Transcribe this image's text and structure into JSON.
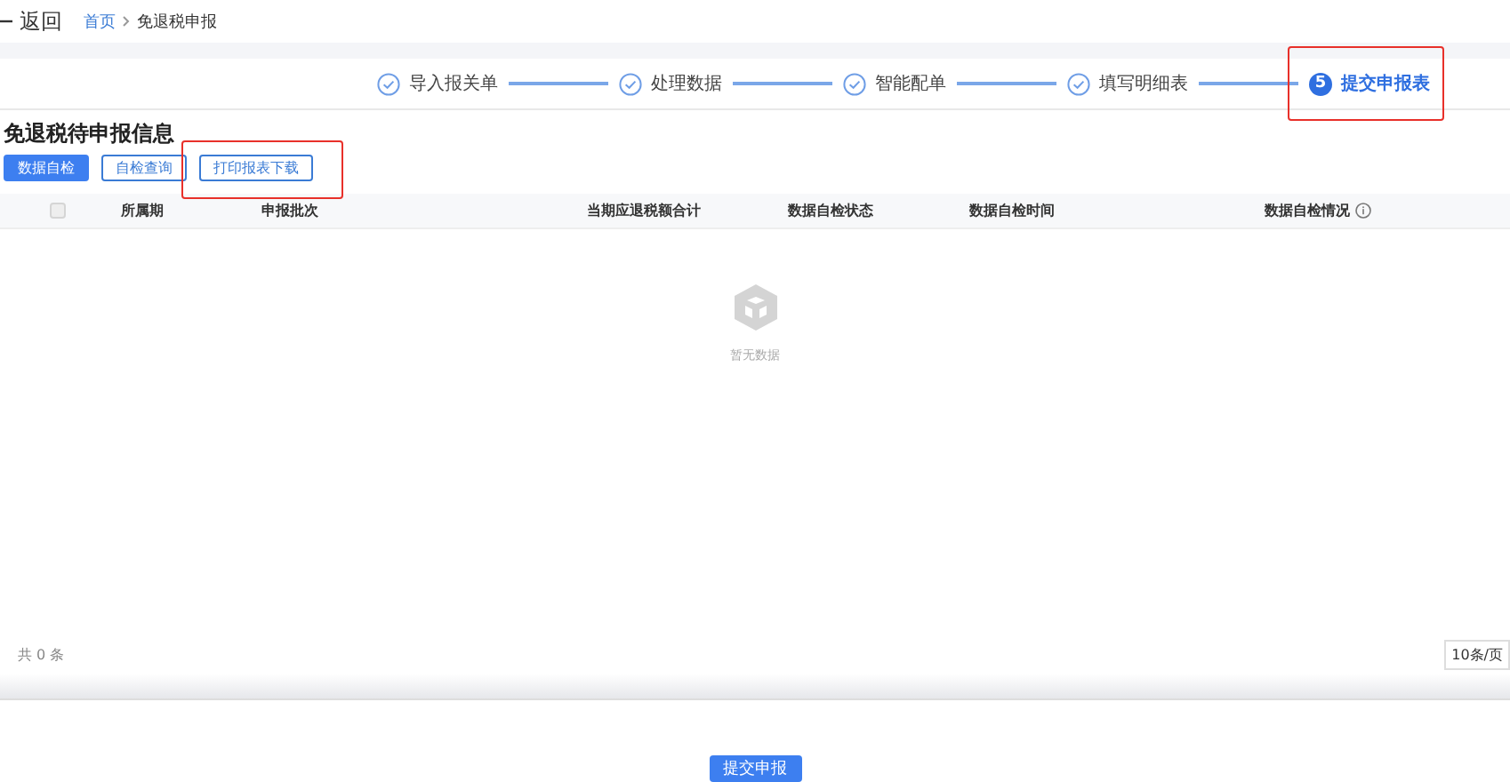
{
  "header": {
    "back_label": "返回",
    "breadcrumb": [
      {
        "label": "首页",
        "current": false
      },
      {
        "label": "免退税申报",
        "current": true
      }
    ]
  },
  "steps": [
    {
      "label": "导入报关单",
      "done": true,
      "highlighted": false
    },
    {
      "label": "处理数据",
      "done": true,
      "highlighted": false
    },
    {
      "label": "智能配单",
      "done": true,
      "highlighted": false
    },
    {
      "label": "填写明细表",
      "done": true,
      "highlighted": false
    },
    {
      "number": "5",
      "label": "提交申报表",
      "done": false,
      "highlighted": true
    }
  ],
  "section_title": "免退税待申报信息",
  "buttons": [
    {
      "label": "数据自检",
      "kind": "primary",
      "highlighted": false
    },
    {
      "label": "自检查询",
      "kind": "default",
      "highlighted": false
    },
    {
      "label": "打印报表下载",
      "kind": "default",
      "highlighted": true
    }
  ],
  "table": {
    "select_all": {
      "checked": false
    },
    "columns": [
      {
        "label": "所属期",
        "info": false
      },
      {
        "label": "申报批次",
        "info": false
      },
      {
        "label": "当期应退税额合计",
        "info": false
      },
      {
        "label": "数据自检状态",
        "info": false
      },
      {
        "label": "数据自检时间",
        "info": false
      },
      {
        "label": "数据自检情况",
        "info": true
      }
    ],
    "empty_text": "暂无数据"
  },
  "pagination": {
    "total": "共 0 条",
    "page_size": "10条/页"
  },
  "submit_button": "提交申报"
}
